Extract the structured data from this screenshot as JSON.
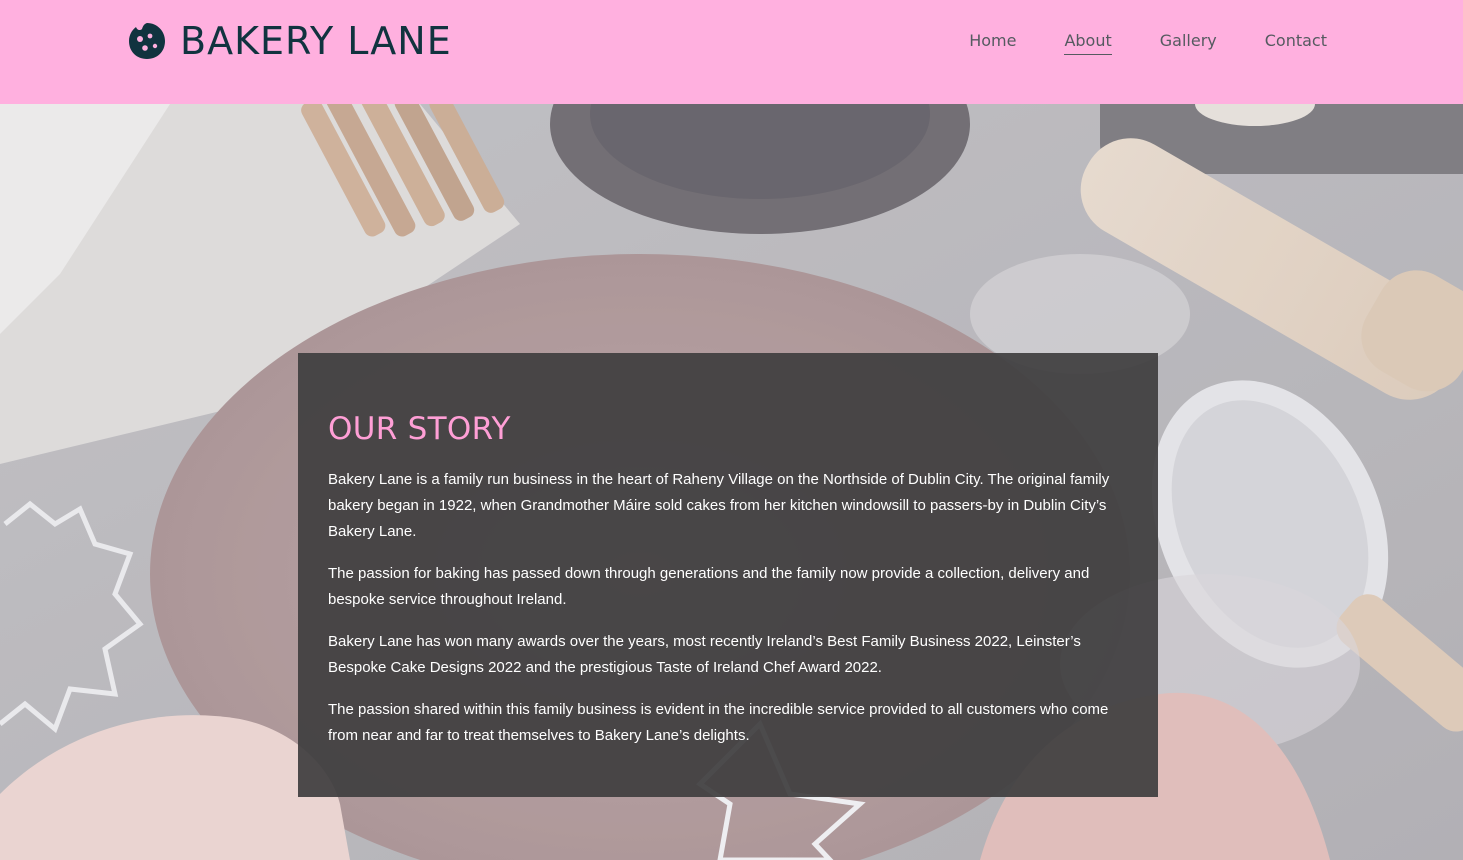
{
  "brand": {
    "name": "BAKERY LANE",
    "icon": "cookie-icon",
    "text_color": "#11333f"
  },
  "header": {
    "background": "#ffb0df"
  },
  "nav": {
    "items": [
      {
        "label": "Home",
        "active": false
      },
      {
        "label": "About",
        "active": true
      },
      {
        "label": "Gallery",
        "active": false
      },
      {
        "label": "Contact",
        "active": false
      }
    ]
  },
  "story": {
    "title": "OUR STORY",
    "title_color": "#ff9fd6",
    "paragraphs": [
      "Bakery Lane is a family run business in the heart of Raheny Village on the Northside of Dublin City. The original family bakery began in 1922, when Grandmother Máire sold cakes from her kitchen windowsill to passers-by in Dublin City’s Bakery Lane.",
      "The passion for baking has passed down through generations and the family now provide a collection, delivery and bespoke service throughout Ireland.",
      "Bakery Lane has won many awards over the years, most recently Ireland’s Best Family Business 2022, Leinster’s Bespoke Cake Designs 2022 and the prestigious Taste of Ireland Chef Award 2022.",
      "The passion shared within this family business is evident in the incredible service provided to all customers who come from near and far to treat themselves to Bakery Lane’s delights."
    ]
  },
  "hero": {
    "image": "baking-scene-background"
  }
}
